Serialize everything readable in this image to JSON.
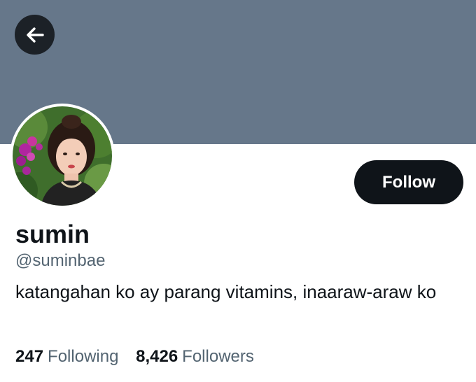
{
  "header": {
    "banner_color": "#66778a",
    "back_icon": "arrow-left-icon"
  },
  "profile": {
    "display_name": "sumin",
    "handle": "@suminbae",
    "bio": "katangahan ko ay parang vitamins, inaaraw-araw ko",
    "follow_label": "Follow"
  },
  "stats": {
    "following_count": "247",
    "following_label": "Following",
    "followers_count": "8,426",
    "followers_label": "Followers"
  },
  "colors": {
    "text_primary": "#0f1419",
    "text_secondary": "#536471",
    "button_bg": "#0f1419"
  }
}
